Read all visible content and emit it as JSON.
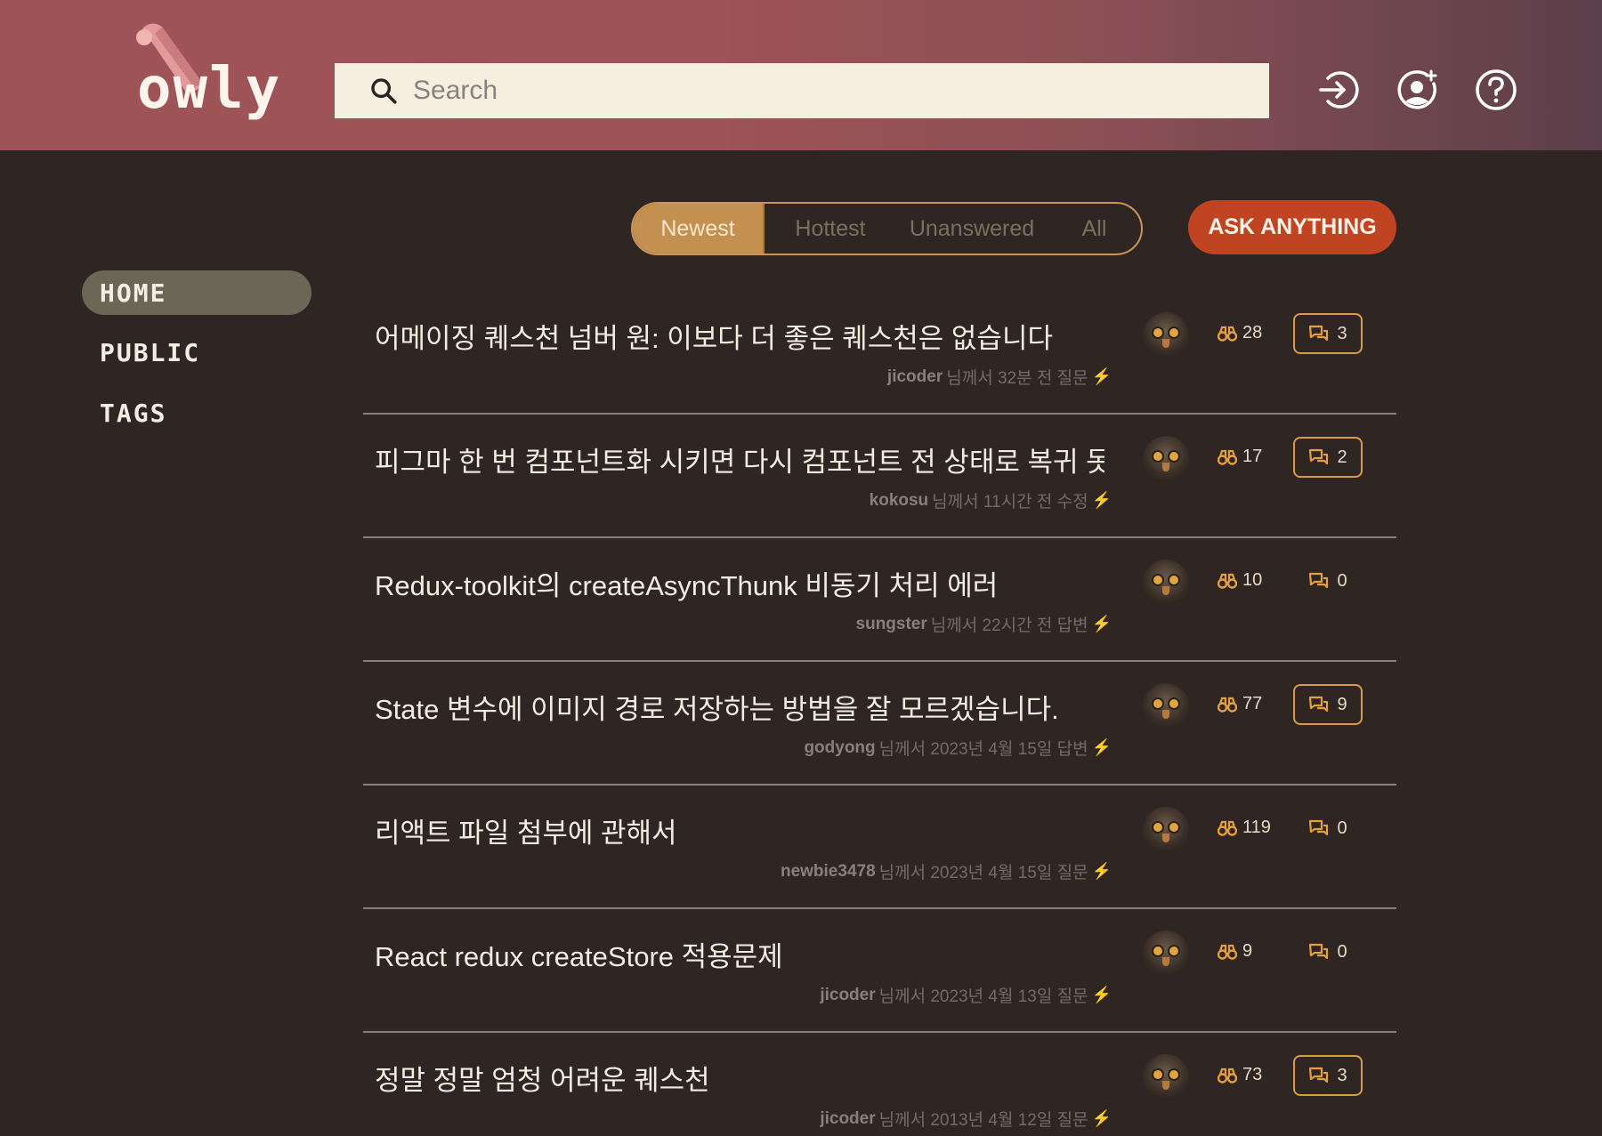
{
  "header": {
    "logo_text": "owly",
    "search": {
      "placeholder": "Search"
    },
    "icons": [
      "login-icon",
      "user-add-icon",
      "help-icon"
    ]
  },
  "sidebar": {
    "items": [
      {
        "label": "HOME",
        "active": true
      },
      {
        "label": "PUBLIC",
        "active": false
      },
      {
        "label": "TAGS",
        "active": false
      }
    ]
  },
  "filters": {
    "tabs": [
      {
        "label": "Newest",
        "active": true
      },
      {
        "label": "Hottest",
        "active": false
      },
      {
        "label": "Unanswered",
        "active": false
      },
      {
        "label": "All",
        "active": false
      }
    ],
    "ask_label": "ASK ANYTHING"
  },
  "questions": [
    {
      "title": "어메이징 퀘스천 넘버 원: 이보다 더 좋은 퀘스천은 없습니다",
      "author": "jicoder",
      "meta": "님께서 32분 전 질문",
      "views": "28",
      "answers": "3"
    },
    {
      "title": "피그마 한 번 컴포넌트화 시키면 다시 컴포넌트 전 상태로 복귀 못 ...",
      "author": "kokosu",
      "meta": "님께서 11시간 전 수정",
      "views": "17",
      "answers": "2"
    },
    {
      "title": "Redux-toolkit의 createAsyncThunk 비동기 처리 에러",
      "author": "sungster",
      "meta": "님께서 22시간 전 답변",
      "views": "10",
      "answers": "0"
    },
    {
      "title": "State 변수에 이미지 경로 저장하는 방법을 잘 모르겠습니다.",
      "author": "godyong",
      "meta": "님께서 2023년 4월 15일 답변",
      "views": "77",
      "answers": "9"
    },
    {
      "title": "리액트 파일 첨부에 관해서",
      "author": "newbie3478",
      "meta": "님께서 2023년 4월 15일 질문",
      "views": "119",
      "answers": "0"
    },
    {
      "title": "React redux createStore 적용문제",
      "author": "jicoder",
      "meta": "님께서 2023년 4월 13일 질문",
      "views": "9",
      "answers": "0"
    },
    {
      "title": "정말 정말 엄청 어려운 퀘스천",
      "author": "jicoder",
      "meta": "님께서 2013년 4월 12일 질문",
      "views": "73",
      "answers": "3"
    }
  ],
  "colors": {
    "header_start": "#9e5356",
    "header_end": "#5b3f4a",
    "background": "#2f2523",
    "accent": "#c4904f",
    "ask_button": "#c04421",
    "answer_border": "#d79a46"
  }
}
